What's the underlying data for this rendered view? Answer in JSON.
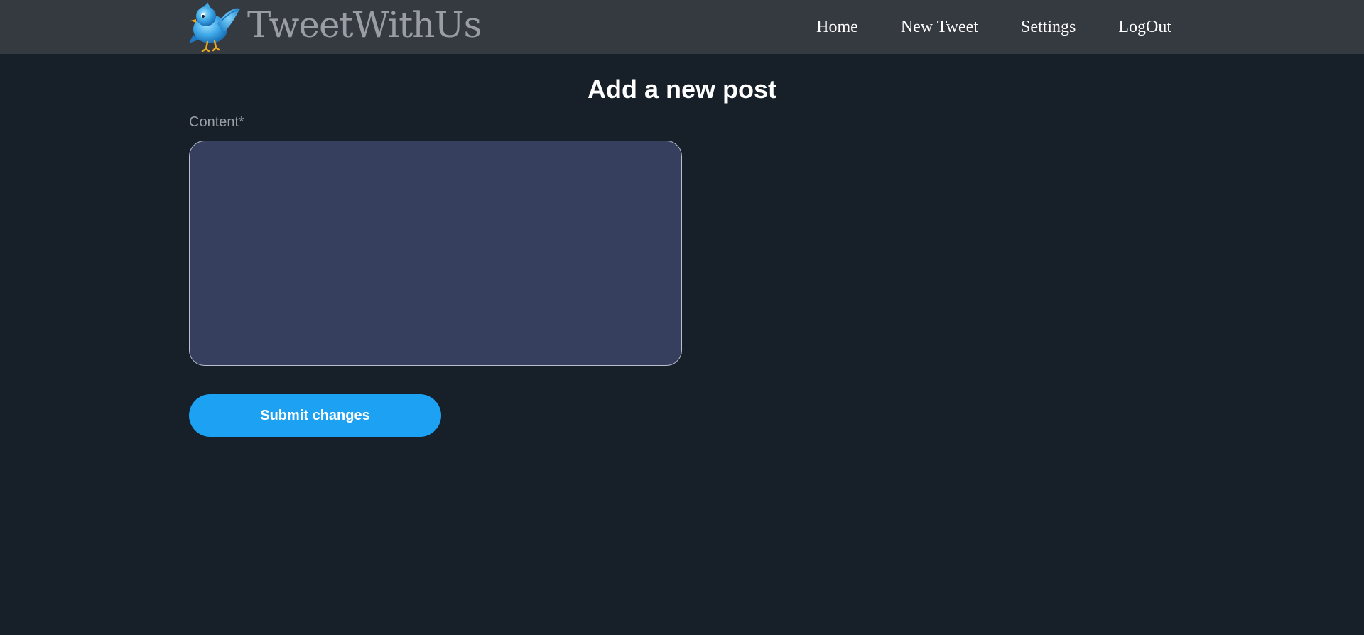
{
  "brand": {
    "name": "TweetWithUs",
    "logo_icon": "bluebird-icon"
  },
  "nav": {
    "items": [
      {
        "label": "Home"
      },
      {
        "label": "New Tweet"
      },
      {
        "label": "Settings"
      },
      {
        "label": "LogOut"
      }
    ]
  },
  "page": {
    "title": "Add a new post"
  },
  "form": {
    "content_label": "Content*",
    "content_value": "",
    "content_placeholder": "",
    "submit_label": "Submit changes"
  },
  "colors": {
    "navbar_bg": "#353a41",
    "page_bg": "#171f29",
    "textarea_bg": "#363f5d",
    "accent": "#1da1f2"
  }
}
